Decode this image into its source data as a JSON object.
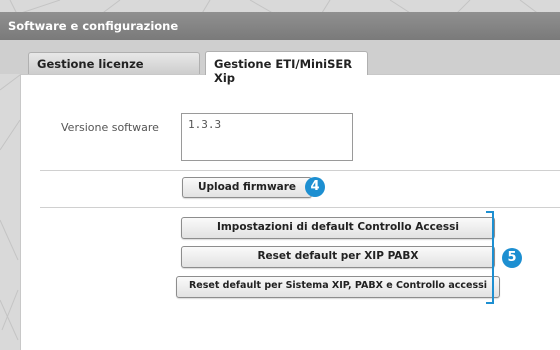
{
  "window": {
    "title": "Software e configurazione"
  },
  "tabs": [
    {
      "label": "Gestione licenze",
      "active": false
    },
    {
      "label": "Gestione ETI/MiniSER Xip",
      "active": true
    }
  ],
  "version": {
    "label": "Versione software",
    "value": "1.3.3"
  },
  "buttons": {
    "upload_firmware": "Upload firmware",
    "default_access_control": "Impostazioni di default Controllo Accessi",
    "reset_xip_pabx": "Reset default per XIP PABX",
    "reset_system": "Reset default per Sistema XIP, PABX e Controllo accessi"
  },
  "callouts": {
    "upload": "4",
    "reset_group": "5"
  },
  "colors": {
    "callout": "#1d8fd1",
    "title_bar": "#808080",
    "panel": "#ffffff"
  }
}
